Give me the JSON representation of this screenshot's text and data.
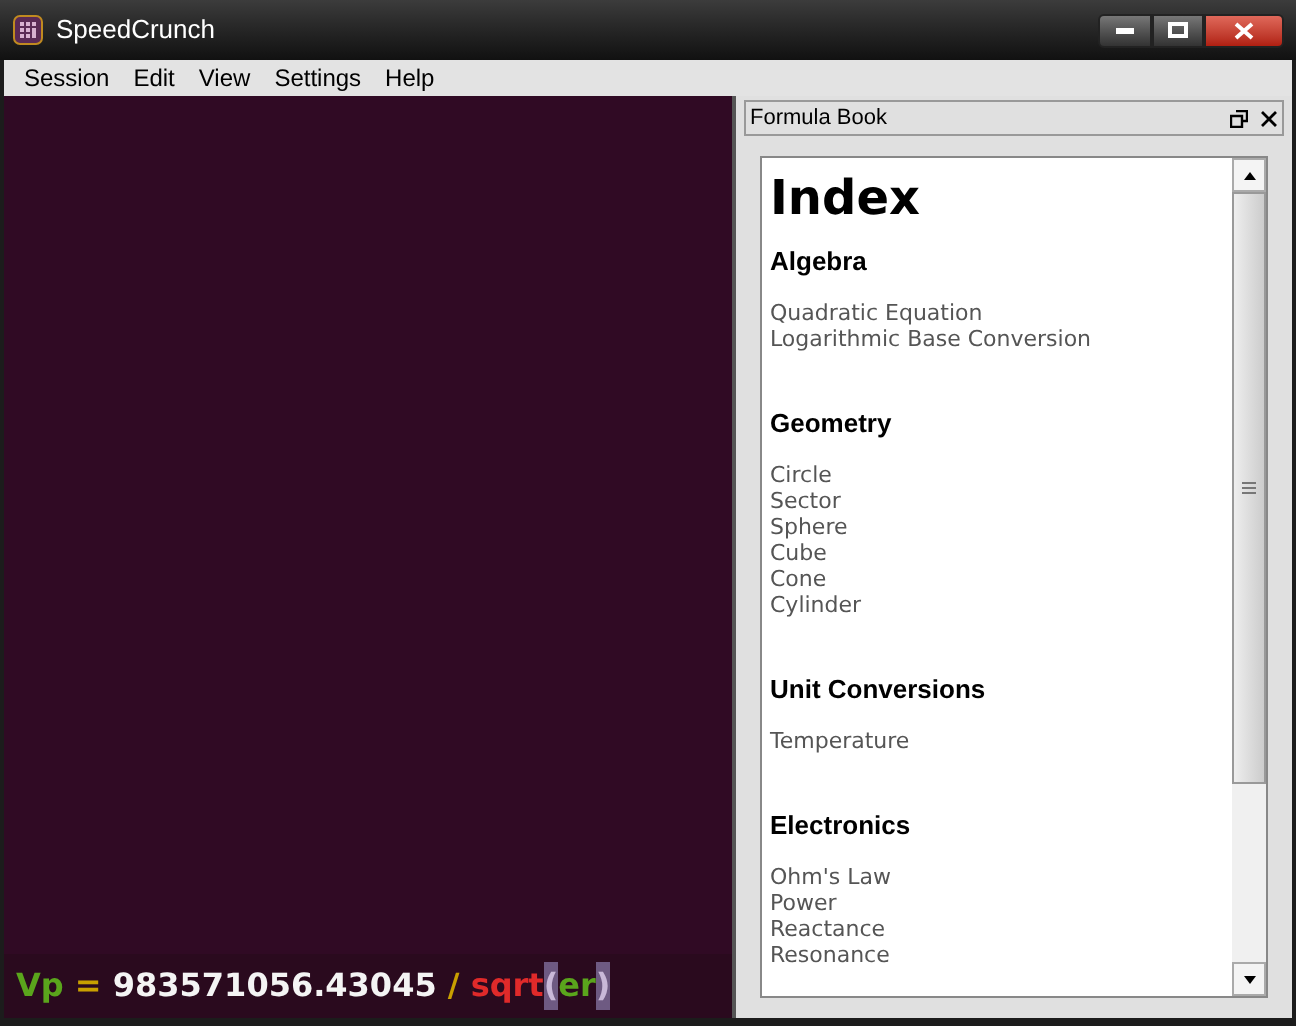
{
  "window": {
    "title": "SpeedCrunch"
  },
  "menu": [
    {
      "label": "Session"
    },
    {
      "label": "Edit"
    },
    {
      "label": "View"
    },
    {
      "label": "Settings"
    },
    {
      "label": "Help"
    }
  ],
  "editor": {
    "tokens": [
      {
        "text": "Vp",
        "kind": "variable"
      },
      {
        "text": " = ",
        "kind": "operator"
      },
      {
        "text": "983571056.43045",
        "kind": "number"
      },
      {
        "text": " / ",
        "kind": "operator"
      },
      {
        "text": "sqrt",
        "kind": "function"
      },
      {
        "text": "(",
        "kind": "paren"
      },
      {
        "text": "er",
        "kind": "variable"
      },
      {
        "text": ")",
        "kind": "paren"
      }
    ]
  },
  "formula_book": {
    "title": "Formula Book",
    "heading": "Index",
    "sections": [
      {
        "title": "Algebra",
        "items": [
          "Quadratic Equation",
          "Logarithmic Base Conversion"
        ]
      },
      {
        "title": "Geometry",
        "items": [
          "Circle",
          "Sector",
          "Sphere",
          "Cube",
          "Cone",
          "Cylinder"
        ]
      },
      {
        "title": "Unit Conversions",
        "items": [
          "Temperature"
        ]
      },
      {
        "title": "Electronics",
        "items": [
          "Ohm's Law",
          "Power",
          "Reactance",
          "Resonance"
        ]
      }
    ]
  }
}
